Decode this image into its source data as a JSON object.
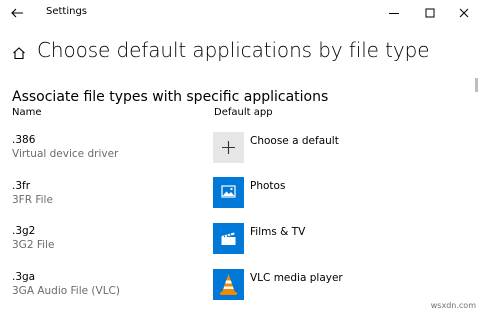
{
  "window": {
    "title": "Settings"
  },
  "page": {
    "title": "Choose default applications by file type",
    "section_title": "Associate file types with specific applications",
    "columns": {
      "name": "Name",
      "default_app": "Default app"
    }
  },
  "rows": [
    {
      "ext": ".386",
      "description": "Virtual device driver",
      "app": "Choose a default",
      "icon": "plus-icon",
      "tile_color": "#e6e6e6"
    },
    {
      "ext": ".3fr",
      "description": "3FR File",
      "app": "Photos",
      "icon": "photos-icon",
      "tile_color": "#0078d7"
    },
    {
      "ext": ".3g2",
      "description": "3G2 File",
      "app": "Films & TV",
      "icon": "films-tv-icon",
      "tile_color": "#0078d7"
    },
    {
      "ext": ".3ga",
      "description": "3GA Audio File (VLC)",
      "app": "VLC media player",
      "icon": "vlc-cone-icon",
      "tile_color": "#0078d7"
    }
  ],
  "watermark": "wsxdn.com"
}
